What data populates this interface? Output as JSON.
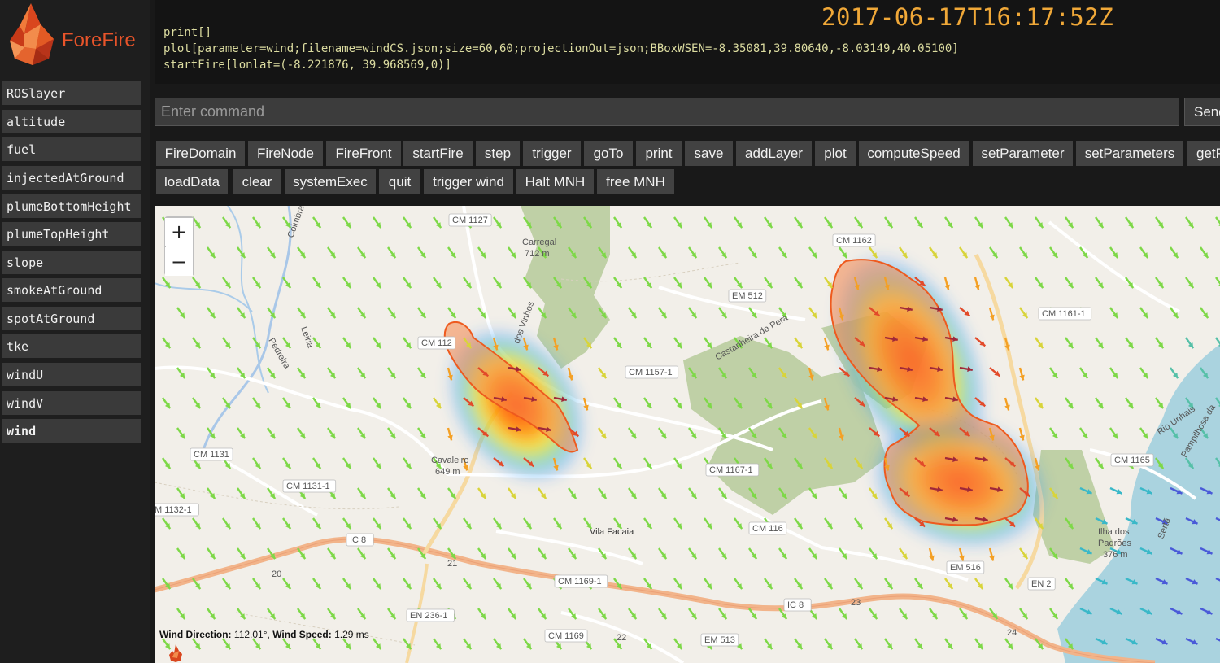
{
  "app": {
    "logo_text": "ForeFire",
    "timestamp": "2017-06-17T16:17:52Z"
  },
  "layers": [
    {
      "label": "ROSlayer"
    },
    {
      "label": "altitude"
    },
    {
      "label": "fuel"
    },
    {
      "label": "injectedAtGround"
    },
    {
      "label": "plumeBottomHeight"
    },
    {
      "label": "plumeTopHeight"
    },
    {
      "label": "slope"
    },
    {
      "label": "smokeAtGround"
    },
    {
      "label": "spotAtGround"
    },
    {
      "label": "tke"
    },
    {
      "label": "windU"
    },
    {
      "label": "windV"
    },
    {
      "label": "wind"
    }
  ],
  "active_layer": "wind",
  "console": {
    "lines": [
      "print[]",
      "plot[parameter=wind;filename=windCS.json;size=60,60;projectionOut=json;BBoxWSEN=-8.35081,39.80640,-8.03149,40.05100]",
      "startFire[lonlat=(-8.221876, 39.968569,0)]"
    ]
  },
  "command": {
    "placeholder": "Enter command",
    "value": "",
    "send_label": "Send"
  },
  "buttons": [
    {
      "label": "FireDomain"
    },
    {
      "label": "FireNode"
    },
    {
      "label": "FireFront"
    },
    {
      "label": "startFire"
    },
    {
      "label": "step"
    },
    {
      "label": "trigger"
    },
    {
      "label": "goTo"
    },
    {
      "label": "print"
    },
    {
      "label": "save"
    },
    {
      "label": "addLayer"
    },
    {
      "label": "plot"
    },
    {
      "label": "computeSpeed"
    },
    {
      "label": "setParameter"
    },
    {
      "label": "setParameters"
    },
    {
      "label": "getParameter"
    },
    {
      "label": "loadData"
    },
    {
      "label": "clear"
    },
    {
      "label": "systemExec"
    },
    {
      "label": "quit"
    },
    {
      "label": "trigger wind"
    },
    {
      "label": "Halt MNH"
    },
    {
      "label": "free MNH"
    }
  ],
  "map": {
    "zoom_in": "+",
    "zoom_out": "−",
    "wind_direction_label": "Wind Direction:",
    "wind_direction_value": "112.01°,",
    "wind_speed_label": "Wind Speed:",
    "wind_speed_value": "1.29 ms",
    "labels": {
      "cm1127": "CM 1127",
      "carregal": "Carregal",
      "carregal_alt": "712 m",
      "cm1162": "CM 1162",
      "em512": "EM 512",
      "cm1161_1": "CM 1161-1",
      "cm112": "CM 112",
      "cm1157_1": "CM 1157-1",
      "cm1131": "CM 1131",
      "cm1131_1": "CM 1131-1",
      "cm1132_1": "M 1132-1",
      "cavaleiro": "Cavaleiro",
      "cavaleiro_alt": "649 m",
      "cm1167_1": "CM 1167-1",
      "cm1165": "CM 1165",
      "ic8_a": "IC 8",
      "vila_facaia": "Vila Facaia",
      "cm116": "CM 116",
      "ilha": "Ilha dos",
      "padroes": "Padrões",
      "padroes_alt": "376 m",
      "em516": "EM 516",
      "en2": "EN 2",
      "cm1169_1": "CM 1169-1",
      "ic8_b": "IC 8",
      "en236_1": "EN 236-1",
      "cm1169": "CM 1169",
      "em513": "EM 513",
      "r21": "21",
      "r20": "20",
      "r23": "23",
      "r24": "24",
      "r22": "22",
      "dos_vinhos": "dos Vinhos",
      "castanheira": "Castanheira de Pera",
      "pedreira": "Pedreira",
      "leiria": "Leiria",
      "coimbra": "Coimbra",
      "rio_unhais": "Rio Unhais",
      "pampilhosa": "Pampilhosa da",
      "serta": "Sertã"
    }
  },
  "colors": {
    "timestamp": "#f0a838",
    "button_bg": "#424242",
    "sidebar_item_bg": "#3a3a3a",
    "fire_front": "#f07030",
    "forest": "#b9cc9e"
  },
  "icons": {
    "logo": "forefire-flame-logo",
    "map_attribution": "flame-icon"
  }
}
